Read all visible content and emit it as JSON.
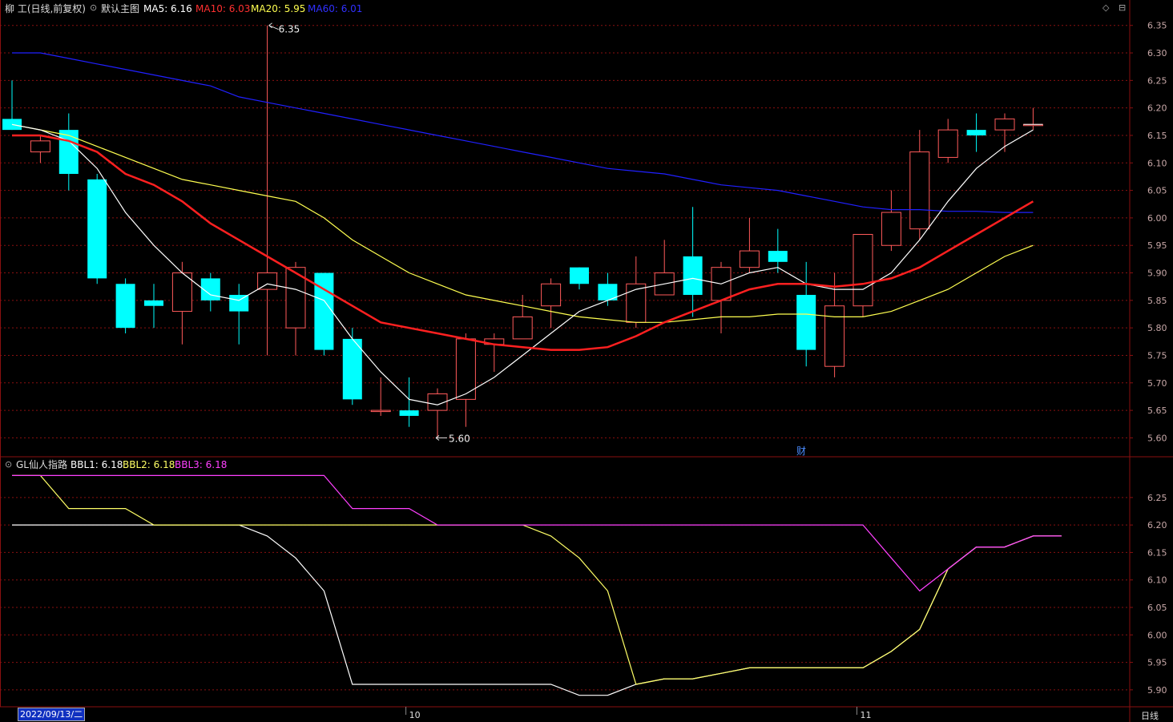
{
  "header": {
    "stock_title": "柳 工(日线,前复权)",
    "main_label": "默认主图",
    "ma5": "MA5: 6.16",
    "ma10": "MA10: 6.03",
    "ma20": "MA20: 5.95",
    "ma60": "MA60: 6.01"
  },
  "indicator": {
    "name": "GL仙人指路",
    "bbl1": "BBL1: 6.18",
    "bbl2": "BBL2: 6.18",
    "bbl3": "BBL3: 6.18"
  },
  "footer": {
    "date_cursor": "2022/09/13/二",
    "month_oct": "10",
    "month_nov": "11",
    "period": "日线"
  },
  "annotations": {
    "high": "6.35",
    "low": "5.60",
    "event_marker": "财"
  },
  "colors": {
    "up": "#ff5a5a",
    "down": "#00ffff",
    "ma5": "#ffffff",
    "ma10": "#ff2020",
    "ma20": "#ffff50",
    "ma60": "#2020ff",
    "bbl1": "#ffffff",
    "bbl2": "#ffff66",
    "bbl3": "#ff40ff",
    "grid": "#8a1010",
    "axis_text": "#c8a8a8"
  },
  "chart_data": [
    {
      "type": "candlestick",
      "ylim": [
        5.57,
        6.37
      ],
      "yticks": [
        5.6,
        5.65,
        5.7,
        5.75,
        5.8,
        5.85,
        5.9,
        5.95,
        6.0,
        6.05,
        6.1,
        6.15,
        6.2,
        6.25,
        6.3,
        6.35
      ],
      "candles": [
        {
          "o": 6.18,
          "c": 6.16,
          "h": 6.25,
          "l": 6.16
        },
        {
          "o": 6.12,
          "c": 6.14,
          "h": 6.15,
          "l": 6.1
        },
        {
          "o": 6.16,
          "c": 6.08,
          "h": 6.19,
          "l": 6.05
        },
        {
          "o": 6.07,
          "c": 5.89,
          "h": 6.08,
          "l": 5.88
        },
        {
          "o": 5.88,
          "c": 5.8,
          "h": 5.89,
          "l": 5.79
        },
        {
          "o": 5.85,
          "c": 5.84,
          "h": 5.88,
          "l": 5.8
        },
        {
          "o": 5.83,
          "c": 5.9,
          "h": 5.92,
          "l": 5.77
        },
        {
          "o": 5.89,
          "c": 5.85,
          "h": 5.9,
          "l": 5.83
        },
        {
          "o": 5.86,
          "c": 5.83,
          "h": 5.88,
          "l": 5.77
        },
        {
          "o": 5.87,
          "c": 5.9,
          "h": 6.35,
          "l": 5.75
        },
        {
          "o": 5.8,
          "c": 5.91,
          "h": 5.92,
          "l": 5.75
        },
        {
          "o": 5.9,
          "c": 5.76,
          "h": 5.9,
          "l": 5.75
        },
        {
          "o": 5.78,
          "c": 5.67,
          "h": 5.8,
          "l": 5.66
        },
        {
          "o": 5.65,
          "c": 5.65,
          "h": 5.71,
          "l": 5.64
        },
        {
          "o": 5.65,
          "c": 5.64,
          "h": 5.71,
          "l": 5.62
        },
        {
          "o": 5.65,
          "c": 5.68,
          "h": 5.69,
          "l": 5.6
        },
        {
          "o": 5.67,
          "c": 5.78,
          "h": 5.79,
          "l": 5.62
        },
        {
          "o": 5.77,
          "c": 5.78,
          "h": 5.79,
          "l": 5.72
        },
        {
          "o": 5.78,
          "c": 5.82,
          "h": 5.86,
          "l": 5.79
        },
        {
          "o": 5.84,
          "c": 5.88,
          "h": 5.89,
          "l": 5.8
        },
        {
          "o": 5.91,
          "c": 5.88,
          "h": 5.91,
          "l": 5.87
        },
        {
          "o": 5.88,
          "c": 5.85,
          "h": 5.9,
          "l": 5.84
        },
        {
          "o": 5.81,
          "c": 5.88,
          "h": 5.93,
          "l": 5.8
        },
        {
          "o": 5.86,
          "c": 5.9,
          "h": 5.96,
          "l": 5.86
        },
        {
          "o": 5.93,
          "c": 5.86,
          "h": 6.02,
          "l": 5.82
        },
        {
          "o": 5.85,
          "c": 5.91,
          "h": 5.92,
          "l": 5.79
        },
        {
          "o": 5.91,
          "c": 5.94,
          "h": 6.0,
          "l": 5.9
        },
        {
          "o": 5.94,
          "c": 5.92,
          "h": 5.98,
          "l": 5.9
        },
        {
          "o": 5.86,
          "c": 5.76,
          "h": 5.92,
          "l": 5.73
        },
        {
          "o": 5.73,
          "c": 5.84,
          "h": 5.9,
          "l": 5.71
        },
        {
          "o": 5.84,
          "c": 5.97,
          "h": 5.97,
          "l": 5.82
        },
        {
          "o": 5.95,
          "c": 6.01,
          "h": 6.05,
          "l": 5.94
        },
        {
          "o": 5.98,
          "c": 6.12,
          "h": 6.16,
          "l": 5.96
        },
        {
          "o": 6.11,
          "c": 6.16,
          "h": 6.18,
          "l": 6.1
        },
        {
          "o": 6.16,
          "c": 6.15,
          "h": 6.19,
          "l": 6.12
        },
        {
          "o": 6.16,
          "c": 6.18,
          "h": 6.19,
          "l": 6.12
        },
        {
          "o": 6.17,
          "c": 6.17,
          "h": 6.2,
          "l": 6.16
        }
      ],
      "ma5": [
        6.17,
        6.16,
        6.14,
        6.09,
        6.01,
        5.95,
        5.9,
        5.86,
        5.85,
        5.88,
        5.87,
        5.85,
        5.78,
        5.72,
        5.67,
        5.66,
        5.68,
        5.71,
        5.75,
        5.79,
        5.83,
        5.85,
        5.87,
        5.88,
        5.89,
        5.88,
        5.9,
        5.91,
        5.88,
        5.87,
        5.87,
        5.9,
        5.96,
        6.03,
        6.09,
        6.13,
        6.16
      ],
      "ma10": [
        6.15,
        6.15,
        6.14,
        6.12,
        6.08,
        6.06,
        6.03,
        5.99,
        5.96,
        5.93,
        5.9,
        5.87,
        5.84,
        5.81,
        5.8,
        5.79,
        5.78,
        5.77,
        5.765,
        5.76,
        5.76,
        5.765,
        5.785,
        5.81,
        5.83,
        5.85,
        5.87,
        5.88,
        5.88,
        5.875,
        5.88,
        5.89,
        5.91,
        5.94,
        5.97,
        6.0,
        6.03
      ],
      "ma20": [
        6.17,
        6.16,
        6.15,
        6.13,
        6.11,
        6.09,
        6.07,
        6.06,
        6.05,
        6.04,
        6.03,
        6.0,
        5.96,
        5.93,
        5.9,
        5.88,
        5.86,
        5.85,
        5.84,
        5.83,
        5.82,
        5.815,
        5.81,
        5.81,
        5.815,
        5.82,
        5.82,
        5.825,
        5.825,
        5.82,
        5.82,
        5.83,
        5.85,
        5.87,
        5.9,
        5.93,
        5.95
      ],
      "ma60": [
        6.3,
        6.3,
        6.29,
        6.28,
        6.27,
        6.26,
        6.25,
        6.24,
        6.22,
        6.21,
        6.2,
        6.19,
        6.18,
        6.17,
        6.16,
        6.15,
        6.14,
        6.13,
        6.12,
        6.11,
        6.1,
        6.09,
        6.085,
        6.08,
        6.07,
        6.06,
        6.055,
        6.05,
        6.04,
        6.03,
        6.02,
        6.015,
        6.015,
        6.012,
        6.012,
        6.01,
        6.01
      ]
    },
    {
      "type": "line",
      "ylim": [
        5.875,
        6.295
      ],
      "yticks": [
        5.9,
        5.95,
        6.0,
        6.05,
        6.1,
        6.15,
        6.2,
        6.25
      ],
      "series": [
        {
          "name": "BBL1",
          "values": [
            6.2,
            6.2,
            6.2,
            6.2,
            6.2,
            6.2,
            6.2,
            6.2,
            6.2,
            6.18,
            6.14,
            6.08,
            5.91,
            5.91,
            5.91,
            5.91,
            5.91,
            5.91,
            5.91,
            5.91,
            5.89,
            5.89,
            5.91,
            5.92,
            5.92,
            5.93,
            5.94,
            5.94,
            5.94,
            5.94,
            5.94,
            5.97,
            6.01,
            6.12,
            6.16,
            6.16,
            6.18,
            6.18
          ]
        },
        {
          "name": "BBL2",
          "values": [
            6.29,
            6.29,
            6.23,
            6.23,
            6.23,
            6.2,
            6.2,
            6.2,
            6.2,
            6.2,
            6.2,
            6.2,
            6.2,
            6.2,
            6.2,
            6.2,
            6.2,
            6.2,
            6.2,
            6.18,
            6.14,
            6.08,
            5.91,
            5.92,
            5.92,
            5.93,
            5.94,
            5.94,
            5.94,
            5.94,
            5.94,
            5.97,
            6.01,
            6.12,
            6.16,
            6.16,
            6.18,
            6.18
          ]
        },
        {
          "name": "BBL3",
          "values": [
            6.29,
            6.29,
            6.29,
            6.29,
            6.29,
            6.29,
            6.29,
            6.29,
            6.29,
            6.29,
            6.29,
            6.29,
            6.23,
            6.23,
            6.23,
            6.2,
            6.2,
            6.2,
            6.2,
            6.2,
            6.2,
            6.2,
            6.2,
            6.2,
            6.2,
            6.2,
            6.2,
            6.2,
            6.2,
            6.2,
            6.2,
            6.14,
            6.08,
            6.12,
            6.16,
            6.16,
            6.18,
            6.18
          ]
        }
      ]
    }
  ]
}
